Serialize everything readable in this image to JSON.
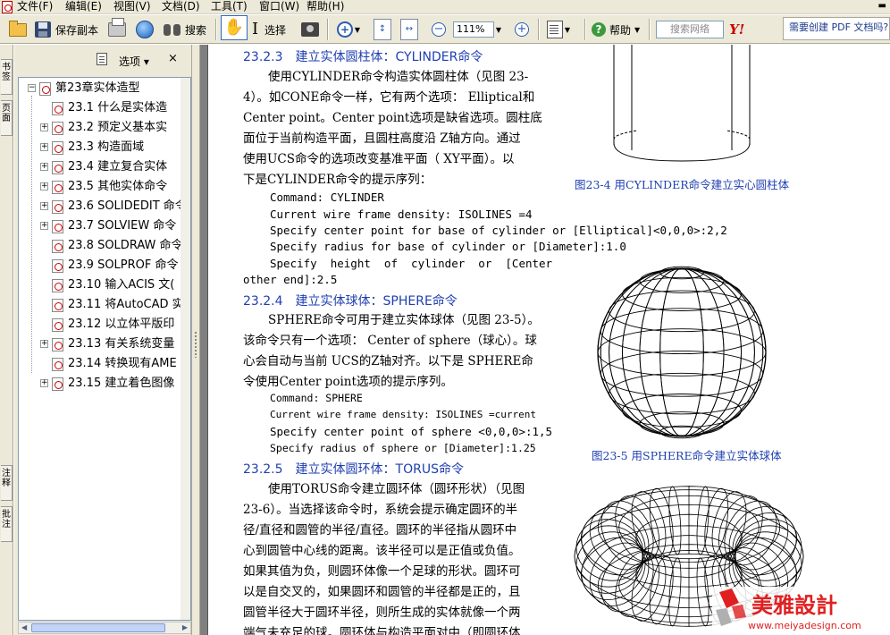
{
  "menu": {
    "items": [
      "文件(F)",
      "编辑(E)",
      "视图(V)",
      "文档(D)",
      "工具(T)",
      "窗口(W)",
      "帮助(H)"
    ]
  },
  "toolbar": {
    "save_copy_label": "保存副本",
    "search_label": "搜索",
    "select_label": "选择",
    "zoom_value": "111%",
    "help_label": "帮助",
    "web_search_placeholder": "搜索网络",
    "ad_text": "需要创建 PDF 文档吗?"
  },
  "side_tabs": [
    "书签",
    "页面",
    "注释",
    "批注"
  ],
  "panel": {
    "options_label": "选项",
    "close_glyph": "×",
    "bookmarks": [
      {
        "label": "第23章实体造型",
        "level": 0,
        "expander": "−"
      },
      {
        "label": "23.1 什么是实体造",
        "level": 1,
        "expander": ""
      },
      {
        "label": "23.2 预定义基本实",
        "level": 1,
        "expander": "+"
      },
      {
        "label": "23.3 构造面域",
        "level": 1,
        "expander": "+"
      },
      {
        "label": "23.4 建立复合实体",
        "level": 1,
        "expander": "+"
      },
      {
        "label": "23.5 其他实体命令",
        "level": 1,
        "expander": "+"
      },
      {
        "label": "23.6 SOLIDEDIT 命令",
        "level": 1,
        "expander": "+"
      },
      {
        "label": "23.7 SOLVIEW 命令",
        "level": 1,
        "expander": "+"
      },
      {
        "label": "23.8 SOLDRAW 命令",
        "level": 1,
        "expander": ""
      },
      {
        "label": "23.9 SOLPROF 命令",
        "level": 1,
        "expander": ""
      },
      {
        "label": "23.10 输入ACIS 文(",
        "level": 1,
        "expander": ""
      },
      {
        "label": "23.11 将AutoCAD 实",
        "level": 1,
        "expander": ""
      },
      {
        "label": "23.12 以立体平版印",
        "level": 1,
        "expander": ""
      },
      {
        "label": "23.13 有关系统变量",
        "level": 1,
        "expander": "+"
      },
      {
        "label": "23.14 转换现有AME",
        "level": 1,
        "expander": ""
      },
      {
        "label": "23.15 建立着色图像",
        "level": 1,
        "expander": "+"
      }
    ]
  },
  "document": {
    "s1": {
      "num": "23.2.3",
      "title": "建立实体圆柱体：CYLINDER命令",
      "lines": [
        "使用CYLINDER命令构造实体圆柱体（见图 23-",
        "4）。如CONE命令一样，它有两个选项： Elliptical和",
        "Center point。Center point选项是缺省选项。圆柱底",
        "面位于当前构造平面，且圆柱高度沿 Z轴方向。通过",
        "使用UCS命令的选项改变基准平面（ XY平面）。以",
        "下是CYLINDER命令的提示序列："
      ],
      "cmd": [
        "Command: CYLINDER",
        "Current wire frame density: ISOLINES =4",
        "Specify center point for base of cylinder or [Elliptical]<0,0,0>:2,2",
        "Specify radius for base of cylinder or [Diameter]:1.0",
        "Specify  height  of  cylinder  or  [Center",
        "other end]:2.5"
      ],
      "caption": "图23-4   用CYLINDER命令建立实心圆柱体"
    },
    "s2": {
      "num": "23.2.4",
      "title": "建立实体球体：SPHERE命令",
      "lines": [
        "SPHERE命令可用于建立实体球体（见图 23-5）。",
        "该命令只有一个选项： Center of sphere（球心）。球",
        "心会自动与当前 UCS的Z轴对齐。以下是 SPHERE命",
        "令使用Center point选项的提示序列。"
      ],
      "cmd": [
        "Command: SPHERE",
        "Current wire frame density: ISOLINES =current",
        "Specify center point of sphere <0,0,0>:1,5",
        "Specify radius of sphere or [Diameter]:1.25"
      ],
      "caption": "图23-5   用SPHERE命令建立实体球体"
    },
    "s3": {
      "num": "23.2.5",
      "title": "建立实体圆环体：TORUS命令",
      "lines": [
        "使用TORUS命令建立圆环体（圆环形状）（见图",
        "23-6）。当选择该命令时，系统会提示确定圆环的半",
        "径/直径和圆管的半径/直径。圆环的半径指从圆环中",
        "心到圆管中心线的距离。该半径可以是正值或负值。",
        "如果其值为负，则圆环体像一个足球的形状。圆环可",
        "以是自交叉的，如果圆环和圆管的半径都是正的，且",
        "圆管半径大于圆环半径，则所生成的实体就像一个两",
        "端气未充足的球。圆环体与构造平面对中（即圆环体"
      ]
    }
  },
  "watermark": {
    "title": "美雅設計",
    "url": "www.meiyadesign.com",
    "logo_color": "#e02020"
  }
}
